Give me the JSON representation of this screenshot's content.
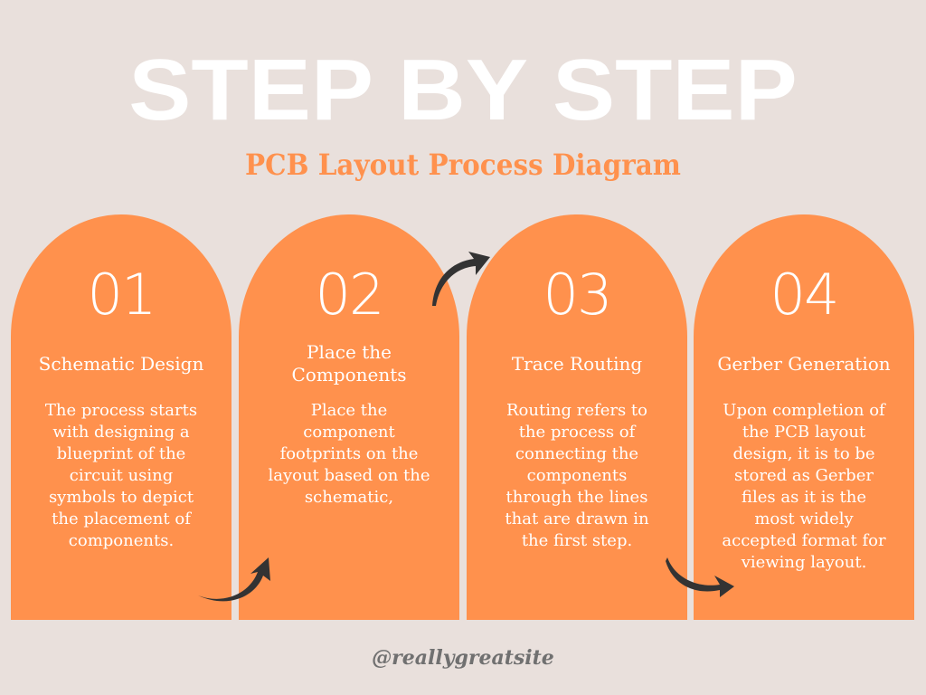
{
  "header": {
    "title": "STEP BY STEP",
    "subtitle": "PCB Layout Process Diagram"
  },
  "colors": {
    "background": "#e9e0dc",
    "card": "#ff914d",
    "subtitle": "#ff914d",
    "arrow": "#333333",
    "footer": "#707070"
  },
  "steps": [
    {
      "number": "01",
      "title": "Schematic Design",
      "description": "The process starts with designing a blueprint of the circuit using symbols to depict the placement of components."
    },
    {
      "number": "02",
      "title": "Place the Components",
      "description": "Place the component footprints on the layout based on the schematic,"
    },
    {
      "number": "03",
      "title": "Trace Routing",
      "description": "Routing refers to the process of connecting the components through the lines that are drawn in the first step."
    },
    {
      "number": "04",
      "title": "Gerber Generation",
      "description": "Upon completion of the PCB layout design, it is to be stored as Gerber files as it is the most widely accepted format for viewing layout."
    }
  ],
  "arrows": [
    {
      "icon": "curved-arrow-icon",
      "from": "01",
      "to": "02"
    },
    {
      "icon": "curved-arrow-icon",
      "from": "02",
      "to": "03"
    },
    {
      "icon": "curved-arrow-icon",
      "from": "03",
      "to": "04"
    }
  ],
  "footer": {
    "handle": "@reallygreatsite"
  }
}
